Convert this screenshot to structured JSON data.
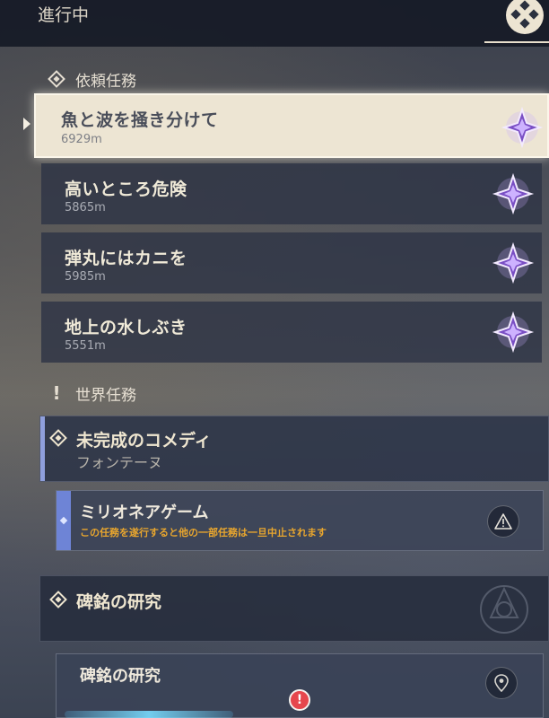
{
  "header": {
    "title": "進行中",
    "menu_icon": "quest-menu-icon"
  },
  "commission": {
    "heading": "依頼任務",
    "heading_icon": "commission-diamond-icon",
    "items": [
      {
        "title": "魚と波を掻き分けて",
        "distance": "6929m",
        "selected": true
      },
      {
        "title": "高いところ危険",
        "distance": "5865m"
      },
      {
        "title": "弾丸にはカニを",
        "distance": "5985m"
      },
      {
        "title": "地上の水しぶき",
        "distance": "5551m"
      }
    ],
    "item_icon": "commission-star-icon"
  },
  "world": {
    "heading": "世界任務",
    "heading_icon": "exclamation-icon",
    "quest": {
      "title": "未完成のコメディ",
      "region": "フォンテーヌ",
      "sub": {
        "title": "ミリオネアゲーム",
        "warning": "この任務を遂行すると他の一部任務は一旦中止されます",
        "button_icon": "warning-icon"
      }
    },
    "quest2": {
      "title": "碑銘の研究",
      "sub": {
        "title": "碑銘の研究",
        "button_icon": "location-pin-icon"
      }
    }
  },
  "colors": {
    "accent_blue": "#6e84d6",
    "warning_orange": "#e8a62e",
    "commission_purple": "#9a6ad8",
    "alert_red": "#e6474d"
  }
}
